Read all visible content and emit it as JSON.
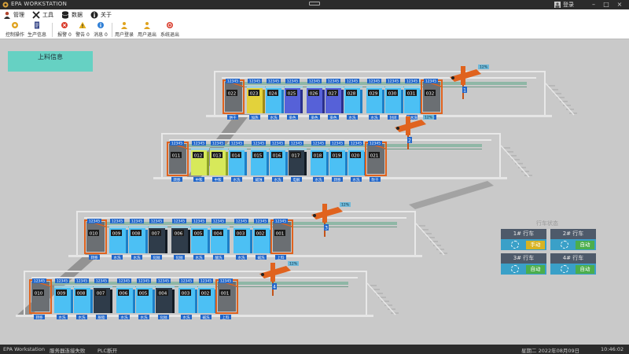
{
  "window": {
    "title": "EPA WORKSTATION",
    "user": "登录"
  },
  "menu": [
    {
      "label": "管理",
      "icon": "user-icon"
    },
    {
      "label": "工具",
      "icon": "tools-icon"
    },
    {
      "label": "数据",
      "icon": "database-icon"
    },
    {
      "label": "关于",
      "icon": "info-icon"
    }
  ],
  "toolbar": [
    {
      "label": "控制操作",
      "icon": "control-icon",
      "color": "#e0a31f"
    },
    {
      "label": "生产信息",
      "icon": "document-icon",
      "color": "#3a4a8a"
    },
    {
      "label": "报警 0",
      "icon": "alarm-icon",
      "color": "#d93b2b"
    },
    {
      "label": "警告 0",
      "icon": "warning-icon",
      "color": "#e8b21d"
    },
    {
      "label": "消息 0",
      "icon": "message-icon",
      "color": "#2f7fd6"
    },
    {
      "label": "用户登录",
      "icon": "user-login-icon",
      "color": "#e0a31f"
    },
    {
      "label": "用户退出",
      "icon": "user-logout-icon",
      "color": "#e0a31f"
    },
    {
      "label": "系统退出",
      "icon": "exit-icon",
      "color": "#d93b2b"
    }
  ],
  "load_info": "上料信息",
  "crane_panel": {
    "title": "行车状态",
    "cranes": [
      {
        "label": "1# 行车",
        "status": "手动",
        "status_color": "#d8b323"
      },
      {
        "label": "2# 行车",
        "status": "自动",
        "status_color": "#4cae4c"
      },
      {
        "label": "3# 行车",
        "status": "自动",
        "status_color": "#4cae4c"
      },
      {
        "label": "4# 行车",
        "status": "自动",
        "status_color": "#4cae4c"
      }
    ]
  },
  "crane_markers": [
    "1",
    "2",
    "3",
    "4"
  ],
  "crane_tag": "12%",
  "tank_tag": "12345",
  "lines": [
    {
      "tanks": [
        {
          "id": "022",
          "label": "烘干",
          "kind": "load"
        },
        {
          "id": "023",
          "label": "加热",
          "kind": "gold"
        },
        {
          "id": "024",
          "label": "水洗",
          "kind": "blue"
        },
        {
          "id": "025",
          "label": "染色",
          "kind": "purple"
        },
        {
          "id": "026",
          "label": "染色",
          "kind": "purple"
        },
        {
          "id": "027",
          "label": "染色",
          "kind": "purple"
        },
        {
          "id": "028",
          "label": "水洗",
          "kind": "blue"
        },
        {
          "id": "029",
          "label": "水洗",
          "kind": "blue"
        },
        {
          "id": "030",
          "label": "封闭",
          "kind": "blue"
        },
        {
          "id": "031",
          "label": "热水洗",
          "kind": "blue"
        },
        {
          "id": "032",
          "label": "吹干",
          "kind": "load"
        }
      ]
    },
    {
      "tanks": [
        {
          "id": "011",
          "label": "转移",
          "kind": "load"
        },
        {
          "id": "012",
          "label": "中和",
          "kind": "yellow"
        },
        {
          "id": "013",
          "label": "中和",
          "kind": "yellow"
        },
        {
          "id": "014",
          "label": "水洗",
          "kind": "blue"
        },
        {
          "id": "015",
          "label": "碱蚀",
          "kind": "blue"
        },
        {
          "id": "016",
          "label": "水洗",
          "kind": "blue"
        },
        {
          "id": "017",
          "label": "电解",
          "kind": "dark"
        },
        {
          "id": "018",
          "label": "水洗",
          "kind": "blue"
        },
        {
          "id": "019",
          "label": "转移",
          "kind": "blue"
        },
        {
          "id": "020",
          "label": "水洗",
          "kind": "blue"
        },
        {
          "id": "021",
          "label": "吹干",
          "kind": "load"
        }
      ]
    },
    {
      "tanks": [
        {
          "id": "010",
          "label": "转移",
          "kind": "load"
        },
        {
          "id": "009",
          "label": "水洗",
          "kind": "blue"
        },
        {
          "id": "008",
          "label": "水洗",
          "kind": "blue"
        },
        {
          "id": "007",
          "label": "化抛",
          "kind": "dark"
        },
        {
          "id": "006",
          "label": "化抛",
          "kind": "dark"
        },
        {
          "id": "005",
          "label": "水洗",
          "kind": "blue"
        },
        {
          "id": "004",
          "label": "酸洗",
          "kind": "blue"
        },
        {
          "id": "003",
          "label": "水洗",
          "kind": "blue"
        },
        {
          "id": "002",
          "label": "碱洗",
          "kind": "blue"
        },
        {
          "id": "001",
          "label": "上料",
          "kind": "load"
        }
      ]
    },
    {
      "tanks": [
        {
          "id": "010",
          "label": "转移",
          "kind": "load"
        },
        {
          "id": "009",
          "label": "水洗",
          "kind": "blue"
        },
        {
          "id": "008",
          "label": "水洗",
          "kind": "blue"
        },
        {
          "id": "007",
          "label": "脱脂",
          "kind": "dark"
        },
        {
          "id": "006",
          "label": "水洗",
          "kind": "blue"
        },
        {
          "id": "005",
          "label": "水洗",
          "kind": "blue"
        },
        {
          "id": "004",
          "label": "化抛",
          "kind": "dark"
        },
        {
          "id": "003",
          "label": "水洗",
          "kind": "blue"
        },
        {
          "id": "002",
          "label": "碱洗",
          "kind": "blue"
        },
        {
          "id": "001",
          "label": "上料",
          "kind": "load"
        }
      ]
    }
  ],
  "colors": {
    "frame": "#e8e8e8",
    "rail": "#8fb7a6",
    "orange": "#e0631e",
    "blue_tank": "#45b4ee",
    "tag": "#2166c9"
  },
  "statusbar": {
    "app": "EPA Workstation",
    "server": "服务器连接失败",
    "plc": "PLC断开",
    "date": "星期二  2022年08月09日",
    "time": "10:46:02"
  }
}
